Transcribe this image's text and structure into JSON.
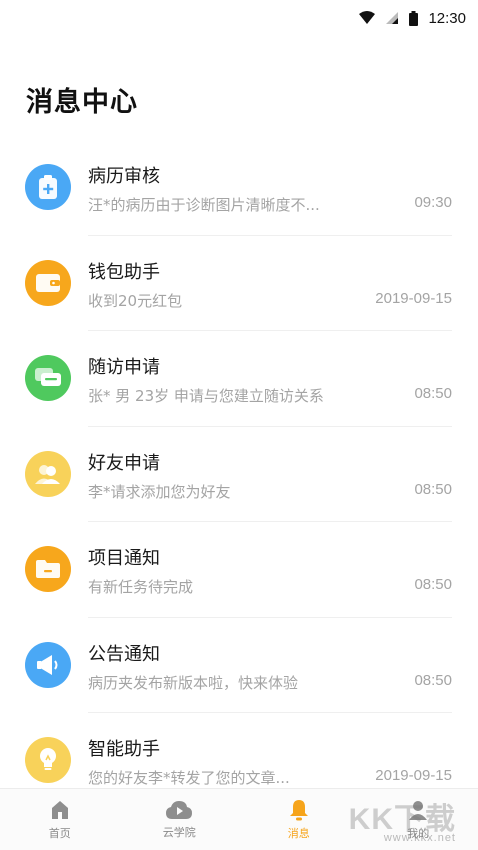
{
  "status_bar": {
    "time": "12:30"
  },
  "page": {
    "title": "消息中心"
  },
  "messages": [
    {
      "title": "病历审核",
      "preview": "汪*的病历由于诊断图片清晰度不...",
      "time": "09:30",
      "icon": "medical-record-icon",
      "color": "#4aa8f5"
    },
    {
      "title": "钱包助手",
      "preview": "收到20元红包",
      "time": "2019-09-15",
      "icon": "wallet-icon",
      "color": "#f7a71c"
    },
    {
      "title": "随访申请",
      "preview": "张* 男 23岁 申请与您建立随访关系",
      "time": "08:50",
      "icon": "chat-bubble-icon",
      "color": "#4fc95e"
    },
    {
      "title": "好友申请",
      "preview": "李*请求添加您为好友",
      "time": "08:50",
      "icon": "friends-icon",
      "color": "#f8d25a"
    },
    {
      "title": "项目通知",
      "preview": "有新任务待完成",
      "time": "08:50",
      "icon": "folder-icon",
      "color": "#f7a71c"
    },
    {
      "title": "公告通知",
      "preview": "病历夹发布新版本啦，快来体验",
      "time": "08:50",
      "icon": "megaphone-icon",
      "color": "#4aa8f5"
    },
    {
      "title": "智能助手",
      "preview": "您的好友李*转发了您的文章...",
      "time": "2019-09-15",
      "icon": "lightbulb-icon",
      "color": "#f8d25a"
    }
  ],
  "tabs": [
    {
      "label": "首页",
      "icon": "home-icon",
      "active": false
    },
    {
      "label": "云学院",
      "icon": "cloud-play-icon",
      "active": false
    },
    {
      "label": "消息",
      "icon": "bell-icon",
      "active": true
    },
    {
      "label": "我的",
      "icon": "profile-icon",
      "active": false
    }
  ],
  "watermark": {
    "text": "KK下载",
    "sub": "www.kkx.net"
  }
}
